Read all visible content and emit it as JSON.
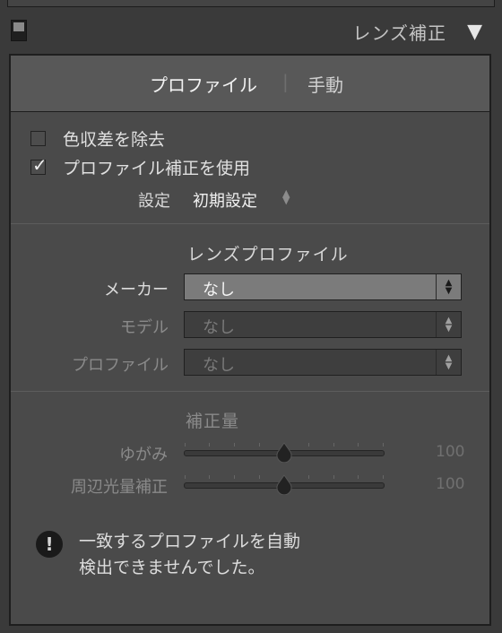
{
  "header": {
    "title": "レンズ補正",
    "collapse_icon": "▼"
  },
  "tabs": [
    {
      "label": "プロファイル",
      "active": true
    },
    {
      "label": "手動",
      "active": false
    }
  ],
  "tab_separator": "|",
  "options": {
    "chromatic_aberration": {
      "label": "色収差を除去",
      "checked": false
    },
    "profile_correction": {
      "label": "プロファイル補正を使用",
      "checked": true
    },
    "checkmark": "✓"
  },
  "setup": {
    "label": "設定",
    "value": "初期設定"
  },
  "lens_profile": {
    "title": "レンズプロファイル",
    "make": {
      "label": "メーカー",
      "value": "なし"
    },
    "model": {
      "label": "モデル",
      "value": "なし"
    },
    "profile": {
      "label": "プロファイル",
      "value": "なし"
    }
  },
  "amount": {
    "title": "補正量",
    "distortion": {
      "label": "ゆがみ",
      "value": "100",
      "position": 0.5
    },
    "vignetting": {
      "label": "周辺光量補正",
      "value": "100",
      "position": 0.5
    }
  },
  "warning": {
    "icon": "!",
    "line1": "一致するプロファイルを自動",
    "line2": "検出できませんでした。"
  },
  "colors": {
    "panel_bg": "#4a4a4a",
    "tabs_bg": "#585858",
    "active_select_bg": "#7b7b7b",
    "disabled_select_bg": "#3e3e3e"
  }
}
